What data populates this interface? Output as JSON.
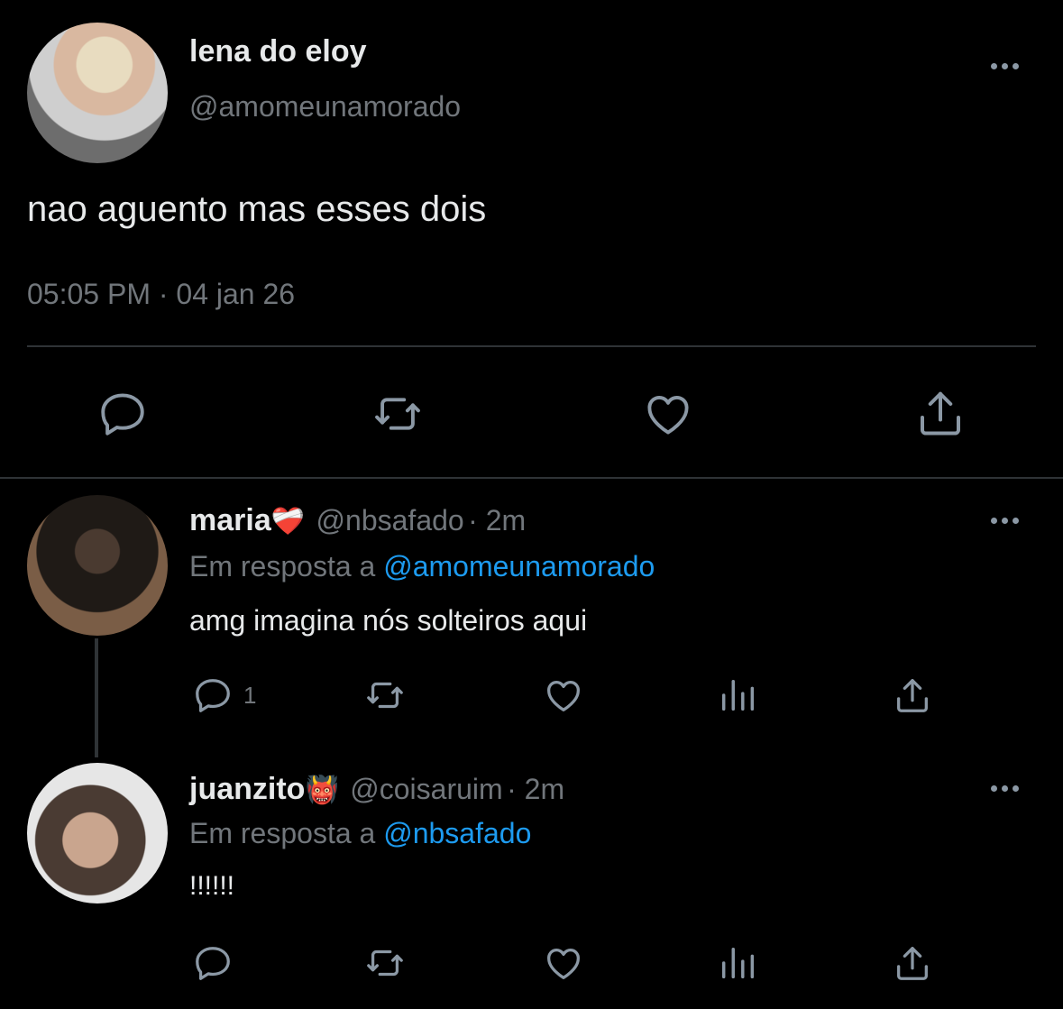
{
  "main_tweet": {
    "author_name": "lena do eloy",
    "author_handle": "@amomeunamorado",
    "text": "nao aguento mas esses dois",
    "timestamp": "05:05 PM · 04 jan 26",
    "actions": [
      "reply-icon",
      "retweet-icon",
      "like-icon",
      "share-icon"
    ]
  },
  "replies": [
    {
      "name": "maria",
      "emoji": "❤️‍🩹",
      "handle": "@nbsafado",
      "time": "· 2m",
      "reply_prefix": "Em resposta a",
      "reply_to": "@amomeunamorado",
      "text": "amg imagina nós solteiros aqui",
      "reply_count": "1"
    },
    {
      "name": "juanzito",
      "emoji": "👹",
      "handle": "@coisaruim",
      "time": "· 2m",
      "reply_prefix": "Em resposta a",
      "reply_to": "@nbsafado",
      "text": "!!!!!!",
      "reply_count": ""
    }
  ],
  "colors": {
    "background": "#000000",
    "text": "#e7e9ea",
    "secondary": "#71767b",
    "link": "#1d9bf0",
    "divider": "#2f3336"
  }
}
